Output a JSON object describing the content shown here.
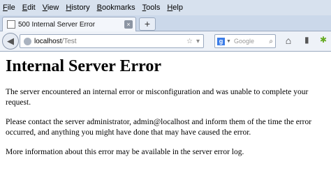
{
  "menu": [
    "File",
    "Edit",
    "View",
    "History",
    "Bookmarks",
    "Tools",
    "Help"
  ],
  "tab": {
    "title": "500 Internal Server Error",
    "close": "×"
  },
  "newtab": "+",
  "nav": {
    "back": "◀",
    "url_host": "localhost",
    "url_path": "/Test",
    "star": "☆",
    "reload": "▾",
    "search_engine": "g",
    "search_placeholder": "Google",
    "search_icon": "⌕",
    "home": "⌂"
  },
  "content": {
    "heading": "Internal Server Error",
    "p1": "The server encountered an internal error or misconfiguration and was unable to complete your request.",
    "p2": "Please contact the server administrator, admin@localhost and inform them of the time the error occurred, and anything you might have done that may have caused the error.",
    "p3": "More information about this error may be available in the server error log."
  }
}
